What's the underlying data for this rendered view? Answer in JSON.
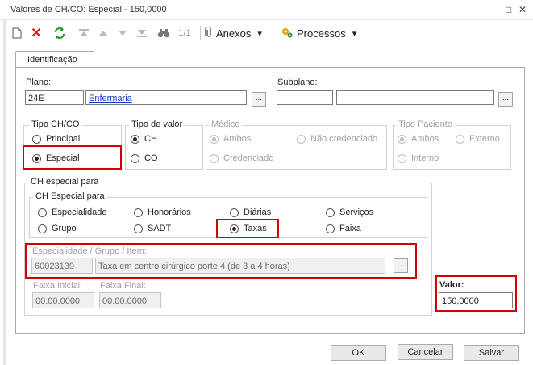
{
  "window": {
    "title": "Valores de CH/CO: Especial - 150,0000",
    "controls": [
      "□",
      "✕"
    ]
  },
  "toolbar": {
    "page_indicator": "1/1",
    "anexos_label": "Anexos",
    "processos_label": "Processos",
    "dropdown_arrow": "▾"
  },
  "tabs": [
    {
      "label": "Identificação"
    }
  ],
  "plano": {
    "label": "Plano:",
    "code": "24E",
    "name": "Enfermaria",
    "lookup": "..."
  },
  "subplano": {
    "label": "Subplano:",
    "code": "",
    "name": "",
    "lookup": "..."
  },
  "tipo_chco": {
    "label": "Tipo CH/CO",
    "options": [
      "Principal",
      "Especial"
    ],
    "selected": "Especial"
  },
  "tipo_valor": {
    "label": "Tipo de valor",
    "options": [
      "CH",
      "CO"
    ],
    "selected": "CH"
  },
  "medico": {
    "label": "Médico",
    "options": [
      "Ambos",
      "Não credenciado",
      "Credenciado"
    ],
    "selected": "Ambos",
    "disabled": true
  },
  "tipo_paciente": {
    "label": "Tipo Paciente",
    "options": [
      "Ambos",
      "Externo",
      "Interno"
    ],
    "selected": "Ambos",
    "disabled": true
  },
  "ch_especial_para": {
    "outer_label": "CH especial para",
    "inner_label": "CH Especial para",
    "options": [
      "Especialidade",
      "Honorários",
      "Diárias",
      "Serviços",
      "Grupo",
      "SADT",
      "Taxas",
      "Faixa"
    ],
    "selected": "Taxas"
  },
  "especialidade": {
    "label": "Especialidade / Grupo / Item:",
    "code": "60023139",
    "description": "Taxa em centro cirúrgico porte 4 (de 3 a 4 horas)",
    "lookup": "..."
  },
  "faixa_inicial": {
    "label": "Faixa Inicial:",
    "value": "00.00.0000"
  },
  "faixa_final": {
    "label": "Faixa Final:",
    "value": "00.00.0000"
  },
  "valor": {
    "label": "Valor:",
    "value": "150,0000"
  },
  "footer": {
    "ok_label": "OK",
    "cancel_label": "Cancelar",
    "save_label": "Salvar"
  },
  "colors": {
    "highlight": "#d20000",
    "link": "#1a33cc",
    "disabled_text": "#a0a0a0"
  }
}
